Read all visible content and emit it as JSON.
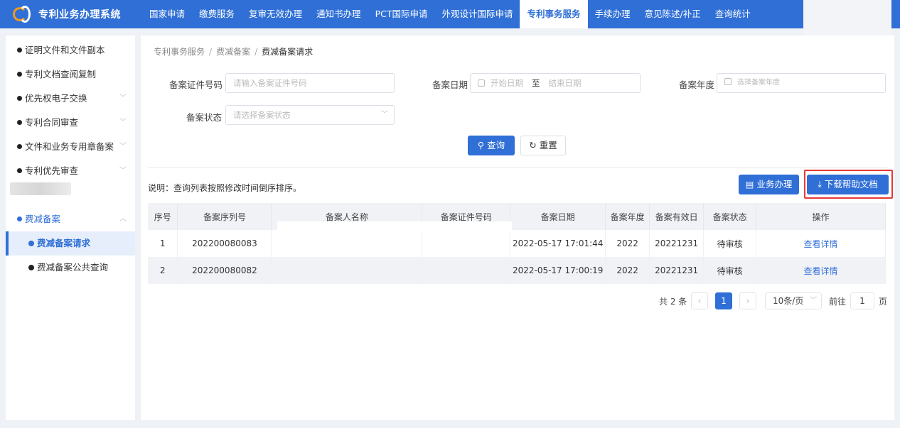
{
  "app": {
    "title": "专利业务办理系统"
  },
  "nav": {
    "items": [
      "国家申请",
      "缴费服务",
      "复审无效办理",
      "通知书办理",
      "PCT国际申请",
      "外观设计国际申请",
      "专利事务服务",
      "手续办理",
      "意见陈述/补正",
      "查询统计"
    ],
    "active_index": 6
  },
  "sidebar": {
    "items": [
      {
        "label": "证明文件和文件副本"
      },
      {
        "label": "专利文档查阅复制"
      },
      {
        "label": "优先权电子交换"
      },
      {
        "label": "专利合同审查"
      },
      {
        "label": "文件和业务专用章备案"
      },
      {
        "label": "专利优先审查"
      }
    ],
    "open_group": "费减备案",
    "sub_items": [
      {
        "label": "费减备案请求",
        "active": true
      },
      {
        "label": "费减备案公共查询",
        "active": false
      }
    ]
  },
  "breadcrumb": {
    "l1": "专利事务服务",
    "l2": "费减备案",
    "l3": "费减备案请求",
    "sep": "/"
  },
  "form": {
    "cert_label": "备案证件号码",
    "cert_placeholder": "请输入备案证件号码",
    "date_label": "备案日期",
    "date_start": "开始日期",
    "date_to": "至",
    "date_end": "结束日期",
    "year_label": "备案年度",
    "year_placeholder": "选择备案年度",
    "status_label": "备案状态",
    "status_placeholder": "请选择备案状态",
    "search_btn": "查询",
    "reset_btn": "重置"
  },
  "note": "说明：查询列表按照修改时间倒序排序。",
  "actions": {
    "process": "业务办理",
    "download": "下载帮助文档"
  },
  "table": {
    "headers": [
      "序号",
      "备案序列号",
      "备案人名称",
      "备案证件号码",
      "备案日期",
      "备案年度",
      "备案有效日",
      "备案状态",
      "操作"
    ],
    "rows": [
      {
        "idx": "1",
        "serial": "202200080083",
        "name": "",
        "cert": "",
        "date": "2022-05-17 17:01:44",
        "year": "2022",
        "valid": "20221231",
        "status": "待审核",
        "op": "查看详情"
      },
      {
        "idx": "2",
        "serial": "202200080082",
        "name": "",
        "cert": "",
        "date": "2022-05-17 17:00:19",
        "year": "2022",
        "valid": "20221231",
        "status": "待审核",
        "op": "查看详情"
      }
    ]
  },
  "pager": {
    "total": "共 2 条",
    "current": "1",
    "size": "10条/页",
    "goto": "前往",
    "goto_value": "1",
    "page_unit": "页"
  },
  "colors": {
    "primary": "#2f6fd6",
    "highlight": "#e53935",
    "accent_logo": "#f29a1f"
  }
}
